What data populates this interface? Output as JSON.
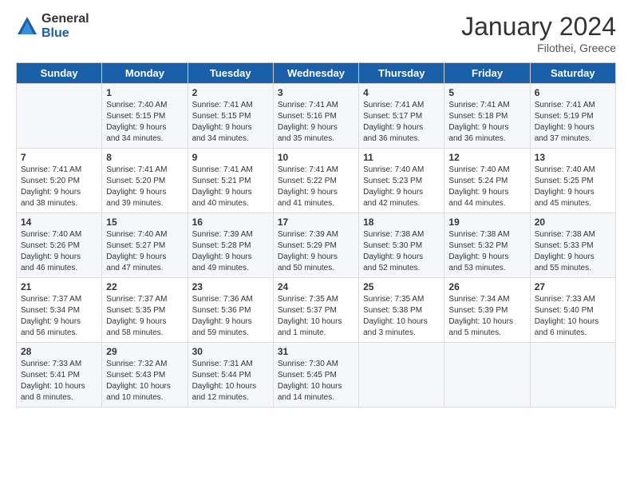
{
  "logo": {
    "general": "General",
    "blue": "Blue"
  },
  "title": "January 2024",
  "subtitle": "Filothei, Greece",
  "days_of_week": [
    "Sunday",
    "Monday",
    "Tuesday",
    "Wednesday",
    "Thursday",
    "Friday",
    "Saturday"
  ],
  "weeks": [
    [
      {
        "day": "",
        "info": ""
      },
      {
        "day": "1",
        "info": "Sunrise: 7:40 AM\nSunset: 5:15 PM\nDaylight: 9 hours\nand 34 minutes."
      },
      {
        "day": "2",
        "info": "Sunrise: 7:41 AM\nSunset: 5:15 PM\nDaylight: 9 hours\nand 34 minutes."
      },
      {
        "day": "3",
        "info": "Sunrise: 7:41 AM\nSunset: 5:16 PM\nDaylight: 9 hours\nand 35 minutes."
      },
      {
        "day": "4",
        "info": "Sunrise: 7:41 AM\nSunset: 5:17 PM\nDaylight: 9 hours\nand 36 minutes."
      },
      {
        "day": "5",
        "info": "Sunrise: 7:41 AM\nSunset: 5:18 PM\nDaylight: 9 hours\nand 36 minutes."
      },
      {
        "day": "6",
        "info": "Sunrise: 7:41 AM\nSunset: 5:19 PM\nDaylight: 9 hours\nand 37 minutes."
      }
    ],
    [
      {
        "day": "7",
        "info": "Sunrise: 7:41 AM\nSunset: 5:20 PM\nDaylight: 9 hours\nand 38 minutes."
      },
      {
        "day": "8",
        "info": "Sunrise: 7:41 AM\nSunset: 5:20 PM\nDaylight: 9 hours\nand 39 minutes."
      },
      {
        "day": "9",
        "info": "Sunrise: 7:41 AM\nSunset: 5:21 PM\nDaylight: 9 hours\nand 40 minutes."
      },
      {
        "day": "10",
        "info": "Sunrise: 7:41 AM\nSunset: 5:22 PM\nDaylight: 9 hours\nand 41 minutes."
      },
      {
        "day": "11",
        "info": "Sunrise: 7:40 AM\nSunset: 5:23 PM\nDaylight: 9 hours\nand 42 minutes."
      },
      {
        "day": "12",
        "info": "Sunrise: 7:40 AM\nSunset: 5:24 PM\nDaylight: 9 hours\nand 44 minutes."
      },
      {
        "day": "13",
        "info": "Sunrise: 7:40 AM\nSunset: 5:25 PM\nDaylight: 9 hours\nand 45 minutes."
      }
    ],
    [
      {
        "day": "14",
        "info": "Sunrise: 7:40 AM\nSunset: 5:26 PM\nDaylight: 9 hours\nand 46 minutes."
      },
      {
        "day": "15",
        "info": "Sunrise: 7:40 AM\nSunset: 5:27 PM\nDaylight: 9 hours\nand 47 minutes."
      },
      {
        "day": "16",
        "info": "Sunrise: 7:39 AM\nSunset: 5:28 PM\nDaylight: 9 hours\nand 49 minutes."
      },
      {
        "day": "17",
        "info": "Sunrise: 7:39 AM\nSunset: 5:29 PM\nDaylight: 9 hours\nand 50 minutes."
      },
      {
        "day": "18",
        "info": "Sunrise: 7:38 AM\nSunset: 5:30 PM\nDaylight: 9 hours\nand 52 minutes."
      },
      {
        "day": "19",
        "info": "Sunrise: 7:38 AM\nSunset: 5:32 PM\nDaylight: 9 hours\nand 53 minutes."
      },
      {
        "day": "20",
        "info": "Sunrise: 7:38 AM\nSunset: 5:33 PM\nDaylight: 9 hours\nand 55 minutes."
      }
    ],
    [
      {
        "day": "21",
        "info": "Sunrise: 7:37 AM\nSunset: 5:34 PM\nDaylight: 9 hours\nand 56 minutes."
      },
      {
        "day": "22",
        "info": "Sunrise: 7:37 AM\nSunset: 5:35 PM\nDaylight: 9 hours\nand 58 minutes."
      },
      {
        "day": "23",
        "info": "Sunrise: 7:36 AM\nSunset: 5:36 PM\nDaylight: 9 hours\nand 59 minutes."
      },
      {
        "day": "24",
        "info": "Sunrise: 7:35 AM\nSunset: 5:37 PM\nDaylight: 10 hours\nand 1 minute."
      },
      {
        "day": "25",
        "info": "Sunrise: 7:35 AM\nSunset: 5:38 PM\nDaylight: 10 hours\nand 3 minutes."
      },
      {
        "day": "26",
        "info": "Sunrise: 7:34 AM\nSunset: 5:39 PM\nDaylight: 10 hours\nand 5 minutes."
      },
      {
        "day": "27",
        "info": "Sunrise: 7:33 AM\nSunset: 5:40 PM\nDaylight: 10 hours\nand 6 minutes."
      }
    ],
    [
      {
        "day": "28",
        "info": "Sunrise: 7:33 AM\nSunset: 5:41 PM\nDaylight: 10 hours\nand 8 minutes."
      },
      {
        "day": "29",
        "info": "Sunrise: 7:32 AM\nSunset: 5:43 PM\nDaylight: 10 hours\nand 10 minutes."
      },
      {
        "day": "30",
        "info": "Sunrise: 7:31 AM\nSunset: 5:44 PM\nDaylight: 10 hours\nand 12 minutes."
      },
      {
        "day": "31",
        "info": "Sunrise: 7:30 AM\nSunset: 5:45 PM\nDaylight: 10 hours\nand 14 minutes."
      },
      {
        "day": "",
        "info": ""
      },
      {
        "day": "",
        "info": ""
      },
      {
        "day": "",
        "info": ""
      }
    ]
  ]
}
